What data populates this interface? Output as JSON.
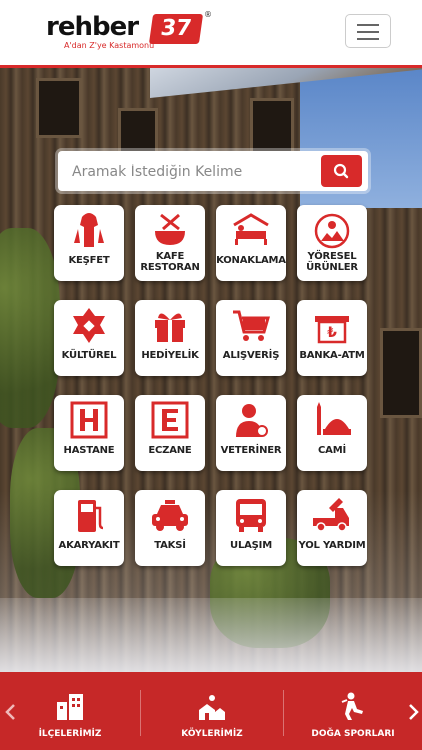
{
  "brand": {
    "word": "rehber",
    "number": "37",
    "tagline": "A'dan Z'ye Kastamonu",
    "reg": "®"
  },
  "search": {
    "placeholder": "Aramak İstediğin Kelime"
  },
  "tiles": [
    {
      "label": "KEŞFET",
      "icon": "explore-icon"
    },
    {
      "label": "KAFE RESTORAN",
      "icon": "cafe-restaurant-icon"
    },
    {
      "label": "KONAKLAMA",
      "icon": "bed-icon"
    },
    {
      "label": "YÖRESEL ÜRÜNLER",
      "icon": "local-products-icon"
    },
    {
      "label": "KÜLTÜREL",
      "icon": "culture-icon"
    },
    {
      "label": "HEDİYELİK",
      "icon": "gift-icon"
    },
    {
      "label": "ALIŞVERİŞ",
      "icon": "shopping-cart-icon"
    },
    {
      "label": "BANKA-ATM",
      "icon": "atm-icon"
    },
    {
      "label": "HASTANE",
      "icon": "hospital-icon"
    },
    {
      "label": "ECZANE",
      "icon": "pharmacy-icon"
    },
    {
      "label": "VETERİNER",
      "icon": "veterinarian-icon"
    },
    {
      "label": "CAMİ",
      "icon": "mosque-icon"
    },
    {
      "label": "AKARYAKIT",
      "icon": "fuel-icon"
    },
    {
      "label": "TAKSİ",
      "icon": "taxi-icon"
    },
    {
      "label": "ULAŞIM",
      "icon": "bus-icon"
    },
    {
      "label": "YOL YARDIM",
      "icon": "tow-truck-icon"
    }
  ],
  "bottom_nav": [
    {
      "label": "İLÇELERİMİZ",
      "icon": "buildings-icon"
    },
    {
      "label": "KÖYLERİMİZ",
      "icon": "village-icon"
    },
    {
      "label": "DOĞA SPORLARI",
      "icon": "climbing-icon"
    }
  ],
  "colors": {
    "accent": "#d82a2a",
    "bottom_bar": "#c62828"
  }
}
